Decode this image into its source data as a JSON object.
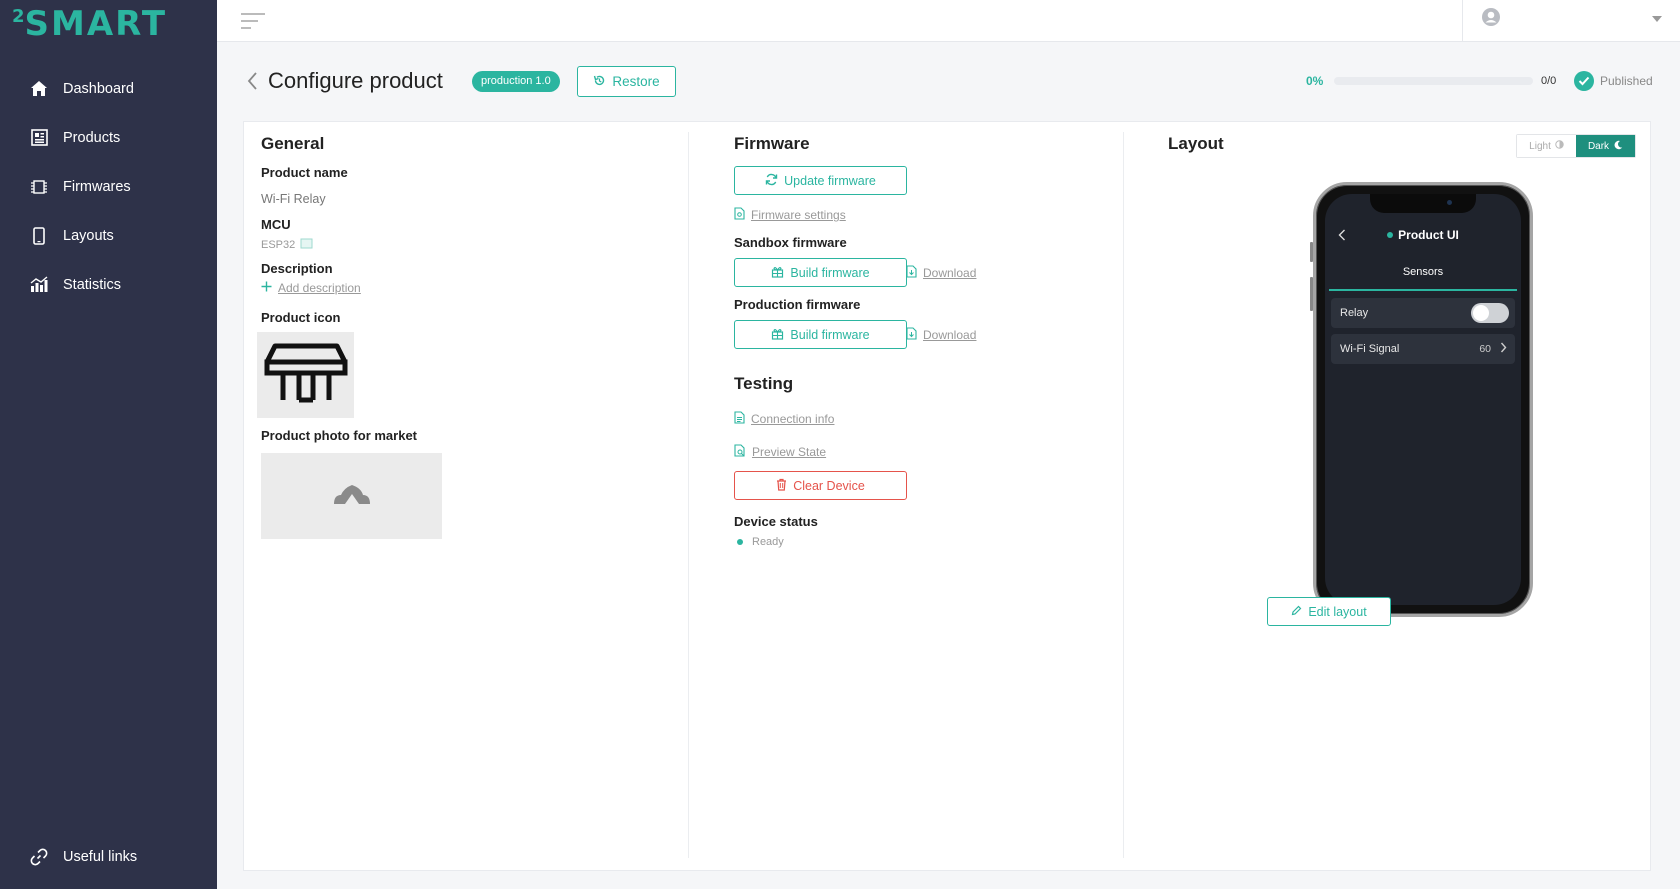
{
  "brand": {
    "sup": "2",
    "word": "SMART"
  },
  "sidebar": {
    "items": [
      {
        "label": "Dashboard",
        "icon": "home-icon"
      },
      {
        "label": "Products",
        "icon": "products-icon"
      },
      {
        "label": "Firmwares",
        "icon": "chip-icon"
      },
      {
        "label": "Layouts",
        "icon": "phone-icon"
      },
      {
        "label": "Statistics",
        "icon": "chart-icon"
      }
    ],
    "useful_links": "Useful links"
  },
  "header": {
    "title": "Configure product",
    "version_badge": "production 1.0",
    "restore_label": "Restore",
    "progress_percent": "0%",
    "progress_fraction": 0,
    "progress_count": "0/0",
    "published_label": "Published"
  },
  "general": {
    "title": "General",
    "product_name_label": "Product name",
    "product_name_value": "Wi-Fi Relay",
    "mcu_label": "MCU",
    "mcu_value": "ESP32",
    "description_label": "Description",
    "add_description": "Add description",
    "product_icon_label": "Product icon",
    "product_photo_label": "Product photo for market"
  },
  "firmware": {
    "title": "Firmware",
    "update_firmware": "Update firmware",
    "firmware_settings": "Firmware settings",
    "sandbox_label": "Sandbox firmware",
    "production_label": "Production firmware",
    "build_firmware": "Build firmware",
    "download": "Download"
  },
  "testing": {
    "title": "Testing",
    "connection_info": "Connection info",
    "preview_state": "Preview State",
    "clear_device": "Clear Device",
    "device_status_label": "Device status",
    "device_status_value": "Ready"
  },
  "layout": {
    "title": "Layout",
    "theme_light": "Light",
    "theme_dark": "Dark",
    "selected_theme": "Dark",
    "edit_layout": "Edit layout",
    "phone": {
      "title": "Product UI",
      "tab": "Sensors",
      "rows": [
        {
          "label": "Relay",
          "type": "toggle",
          "state": "off"
        },
        {
          "label": "Wi-Fi Signal",
          "value": "60"
        }
      ]
    }
  },
  "colors": {
    "accent": "#2bb5a0",
    "sidebar_bg": "#2e3249",
    "danger": "#e5534b"
  }
}
